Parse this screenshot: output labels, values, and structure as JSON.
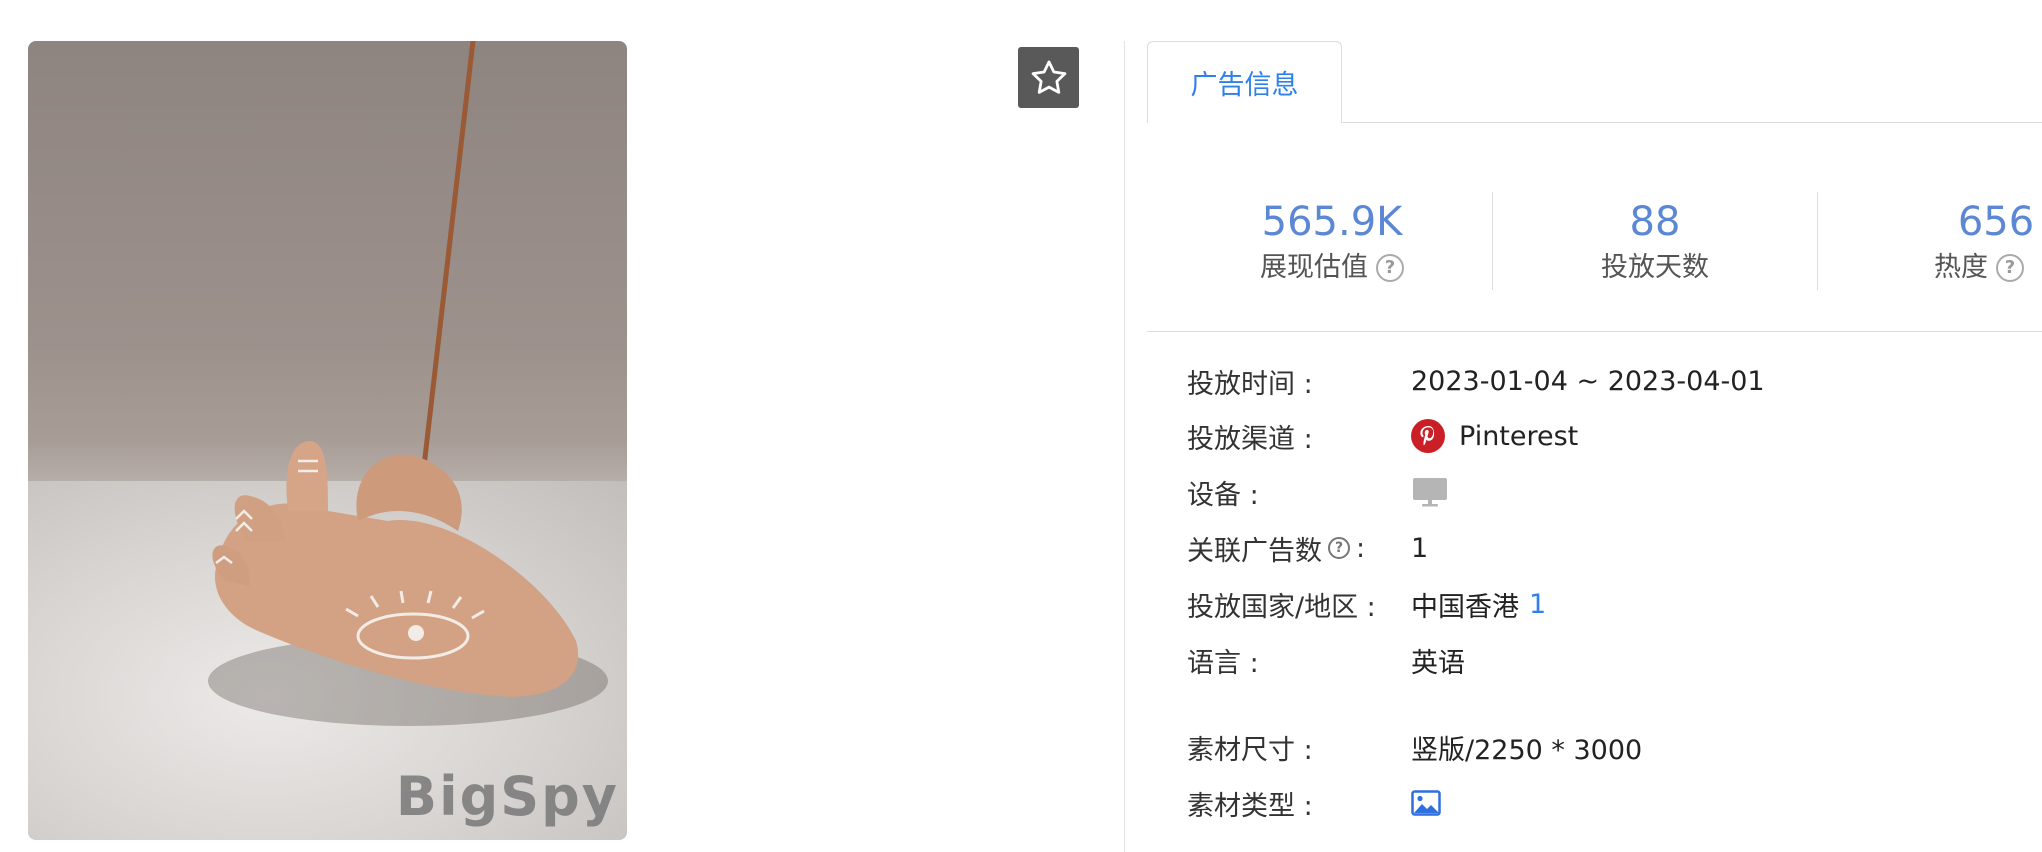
{
  "creative": {
    "watermark": "BigSpy"
  },
  "favorite": {
    "icon": "star-outline-icon"
  },
  "tabs": [
    {
      "label": "广告信息",
      "active": true
    }
  ],
  "stats": [
    {
      "value": "565.9K",
      "label": "展现估值",
      "help": true
    },
    {
      "value": "88",
      "label": "投放天数",
      "help": false
    },
    {
      "value": "656",
      "label": "热度",
      "help": true
    }
  ],
  "info": {
    "time": {
      "key": "投放时间 :",
      "value": "2023-01-04 ~ 2023-04-01"
    },
    "channel": {
      "key": "投放渠道 :",
      "value": "Pinterest",
      "icon": "pinterest-icon"
    },
    "device": {
      "key": "设备 :",
      "icon": "desktop-monitor-icon"
    },
    "related": {
      "key_text": "关联广告数",
      "key_suffix": ":",
      "value": "1"
    },
    "region": {
      "key": "投放国家/地区 :",
      "value": "中国香港",
      "count": "1"
    },
    "language": {
      "key": "语言 :",
      "value": "英语"
    },
    "size": {
      "key": "素材尺寸 :",
      "value": "竖版/2250 * 3000"
    },
    "type": {
      "key": "素材类型 :",
      "icon": "image-icon"
    }
  },
  "colors": {
    "accent": "#2f80ed",
    "stat_number": "#5b87d4",
    "pinterest": "#cb1f27",
    "fav_bg": "#595959"
  }
}
